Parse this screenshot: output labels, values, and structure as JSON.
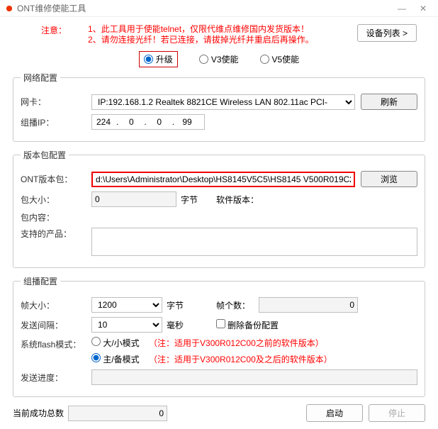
{
  "window": {
    "title": "ONT维修使能工具"
  },
  "notice": {
    "label": "注意：",
    "line1": "1、此工具用于使能telnet，仅限代维点维修国内发货版本！",
    "line2": "2、请勿连接光纤！若已连接，请拔掉光纤并重启后再操作。"
  },
  "buttons": {
    "deviceList": "设备列表 >",
    "refresh": "刷新",
    "browse": "浏览",
    "start": "启动",
    "stop": "停止"
  },
  "modeRadios": {
    "upgrade": "升级",
    "v3": "V3使能",
    "v5": "V5使能"
  },
  "netGroup": {
    "legend": "网络配置",
    "nicLabel": "网卡：",
    "nicValue": "IP:192.168.1.2 Realtek 8821CE Wireless LAN 802.11ac PCI-",
    "multicastLabel": "组播IP：",
    "ip": {
      "a": "224",
      "b": "0",
      "c": "0",
      "d": "99"
    }
  },
  "pkgGroup": {
    "legend": "版本包配置",
    "pathLabel": "ONT版本包：",
    "pathValue": "d:\\Users\\Administrator\\Desktop\\HS8145V5C5\\HS8145 V500R019C2",
    "sizeLabel": "包大小：",
    "sizeValue": "0",
    "byteUnit": "字节",
    "swVerLabel": "软件版本：",
    "contentLabel": "包内容：",
    "productLabel": "支持的产品："
  },
  "mcGroup": {
    "legend": "组播配置",
    "frameSizeLabel": "帧大小：",
    "frameSizeValue": "1200",
    "byteUnit": "字节",
    "frameCountLabel": "帧个数：",
    "frameCountValue": "0",
    "intervalLabel": "发送间隔：",
    "intervalValue": "10",
    "msUnit": "毫秒",
    "deleteBackup": "删除备份配置",
    "flashLabel": "系统flash模式：",
    "flashBig": "大/小模式",
    "flashBigNote": "（注：适用于V300R012C00之前的软件版本）",
    "flashMain": "主/备模式",
    "flashMainNote": "（注：适用于V300R012C00及之后的软件版本）",
    "progressLabel": "发送进度："
  },
  "footer": {
    "successLabel": "当前成功总数",
    "successValue": "0"
  }
}
